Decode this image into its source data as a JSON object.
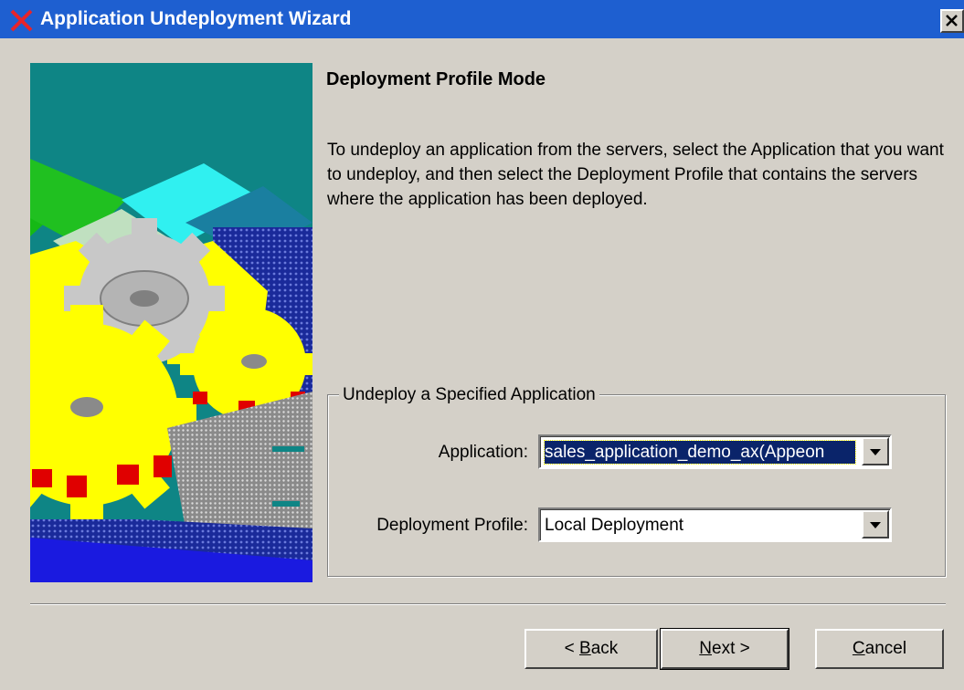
{
  "window": {
    "title": "Application Undeployment Wizard",
    "title_bar_color": "#1e5fd0",
    "app_icon": "x-close-red-icon",
    "close_icon": "close-icon"
  },
  "page": {
    "heading": "Deployment Profile Mode",
    "description": "To undeploy an application from the servers, select the Application that you want to undeploy, and then select the Deployment Profile that contains the servers where the application has been deployed."
  },
  "group": {
    "legend": "Undeploy a Specified Application",
    "application_label": "Application:",
    "application_value": "sales_application_demo_ax(Appeon",
    "profile_label": "Deployment Profile:",
    "profile_value": "Local Deployment"
  },
  "buttons": {
    "back_prefix": "< ",
    "back_accel": "B",
    "back_rest": "ack",
    "next_accel": "N",
    "next_rest": "ext >",
    "cancel_accel": "C",
    "cancel_rest": "ancel"
  },
  "colors": {
    "dialog_bg": "#d4d0c8",
    "selection_bg": "#0a246a"
  }
}
